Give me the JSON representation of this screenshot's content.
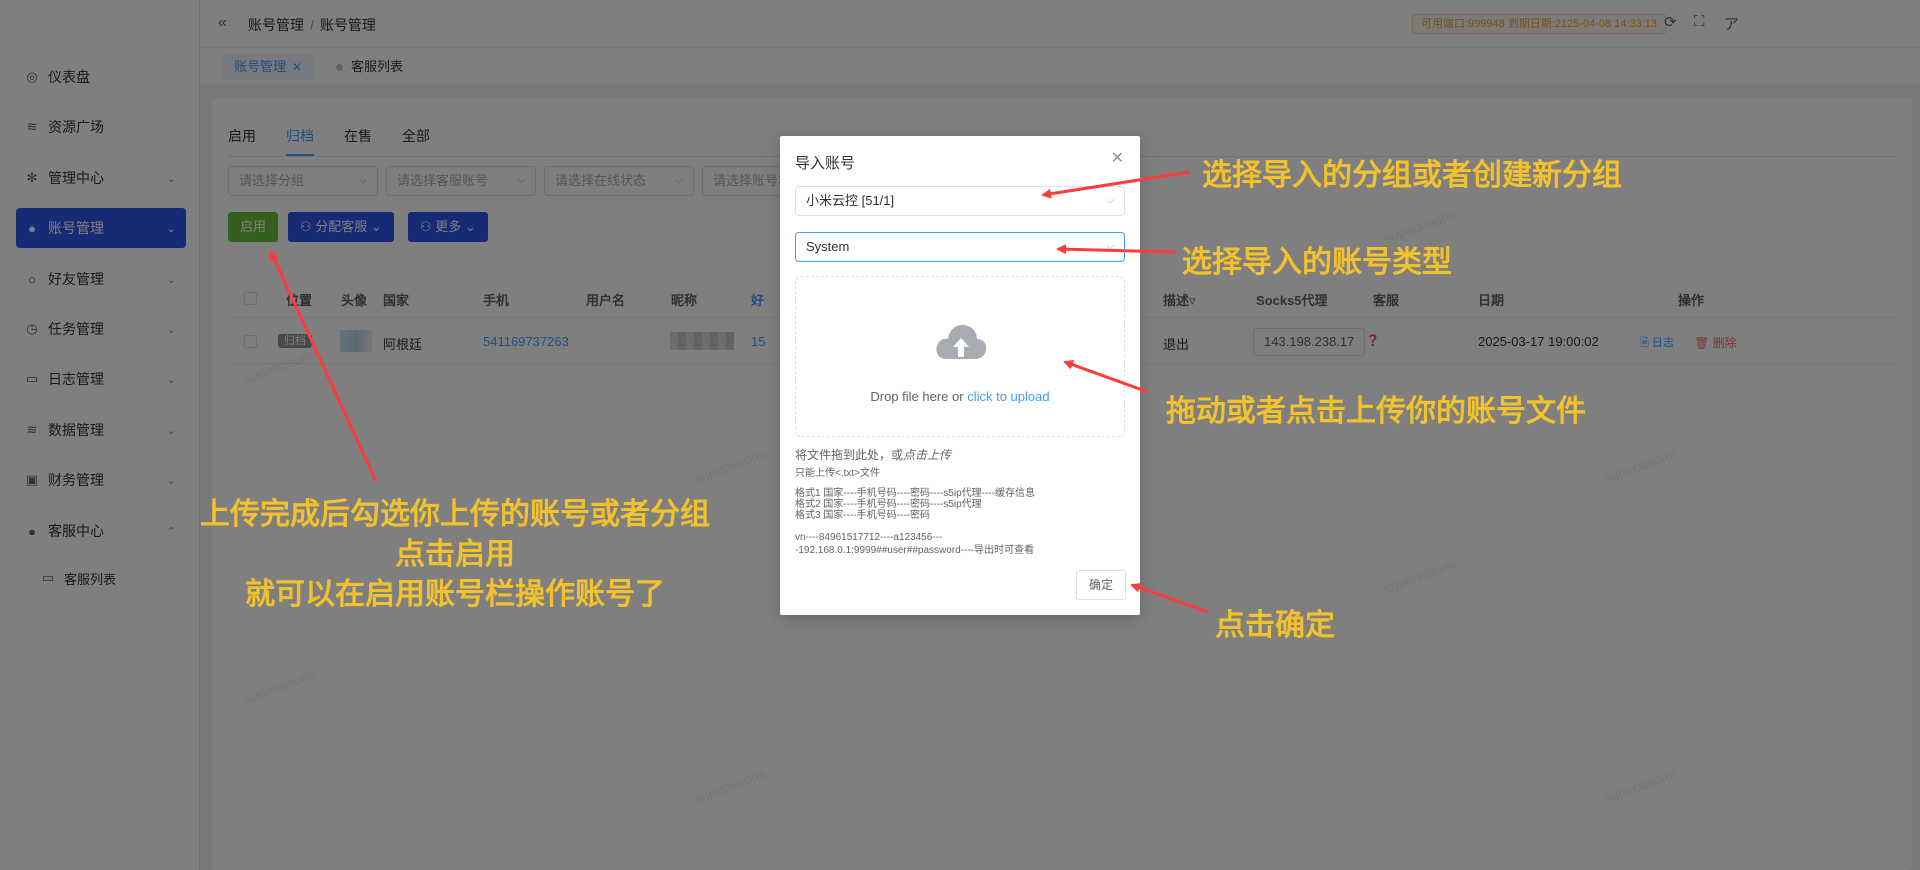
{
  "sidebar": {
    "items": [
      {
        "label": "仪表盘",
        "icon": "dashboard-icon",
        "glyph": "◎"
      },
      {
        "label": "资源广场",
        "icon": "database-icon",
        "glyph": "≋"
      },
      {
        "label": "管理中心",
        "icon": "gear-icon",
        "glyph": "✻"
      },
      {
        "label": "账号管理",
        "icon": "user-icon",
        "glyph": "●"
      },
      {
        "label": "好友管理",
        "icon": "user-outline-icon",
        "glyph": "○"
      },
      {
        "label": "任务管理",
        "icon": "alarm-icon",
        "glyph": "◷"
      },
      {
        "label": "日志管理",
        "icon": "message-icon",
        "glyph": "▭"
      },
      {
        "label": "数据管理",
        "icon": "coins-icon",
        "glyph": "≋"
      },
      {
        "label": "财务管理",
        "icon": "wallet-icon",
        "glyph": "▣"
      },
      {
        "label": "客服中心",
        "icon": "user-icon",
        "glyph": "●"
      }
    ],
    "sub_item": {
      "label": "客服列表",
      "icon": "monitor-icon",
      "glyph": "▭"
    }
  },
  "header": {
    "breadcrumb": [
      "账号管理",
      "账号管理"
    ],
    "expire_text": "可用端口:999948 到期日期:2125-04-08 14:33:13",
    "icons": [
      "refresh-icon",
      "fullscreen-icon",
      "translate-icon"
    ]
  },
  "tagbar": {
    "tags": [
      "账号管理",
      "客服列表"
    ]
  },
  "tabs": [
    "启用",
    "归档",
    "在售",
    "全部"
  ],
  "filters": [
    "请选择分组",
    "请选择客服账号",
    "请选择在线状态",
    "请选择账号状"
  ],
  "buttons": {
    "enable": "启用",
    "assign": "分配客服",
    "more": "更多"
  },
  "table": {
    "headers": [
      "位置",
      "头像",
      "国家",
      "手机",
      "用户名",
      "昵称",
      "好",
      "描述",
      "Socks5代理",
      "客服",
      "日期",
      "操作"
    ],
    "row": {
      "status": "归档",
      "country": "阿根廷",
      "phone": "541169737263",
      "friends_partial": "15",
      "description": "退出",
      "proxy": "143.198.238.17",
      "date": "2025-03-17 19:00:02",
      "log": "日志",
      "delete": "删除"
    }
  },
  "watermark": "superxiaomi",
  "modal": {
    "title": "导入账号",
    "group_value": "小米云控 [51/1]",
    "type_value": "System",
    "upload_text": "Drop file here or",
    "upload_link": "click to upload",
    "tip_main_prefix": "将文件拖到此处，或",
    "tip_main_em": "点击上传",
    "tip_only": "只能上传<.txt>文件",
    "format1": "格式1 国家----手机号码----密码----s5ip代理----缓存信息",
    "format2": "格式2 国家----手机号码----密码----s5ip代理",
    "format3": "格式3 国家----手机号码----密码",
    "example1": "vn----84961517712----a123456---",
    "example2": "-192.168.0.1:9999##user##password----导出时可查看",
    "ok": "确定"
  },
  "annotations": {
    "group": "选择导入的分组或者创建新分组",
    "type": "选择导入的账号类型",
    "upload": "拖动或者点击上传你的账号文件",
    "confirm": "点击确定",
    "enable_line1": "上传完成后勾选你上传的账号或者分组",
    "enable_line2": "点击启用",
    "enable_line3": "就可以在启用账号栏操作账号了"
  },
  "colors": {
    "primary": "#409eff",
    "sidebar_active": "#2f54eb",
    "success": "#67c23a",
    "annotation": "#f2c12e",
    "arrow": "#ff3b3b"
  }
}
